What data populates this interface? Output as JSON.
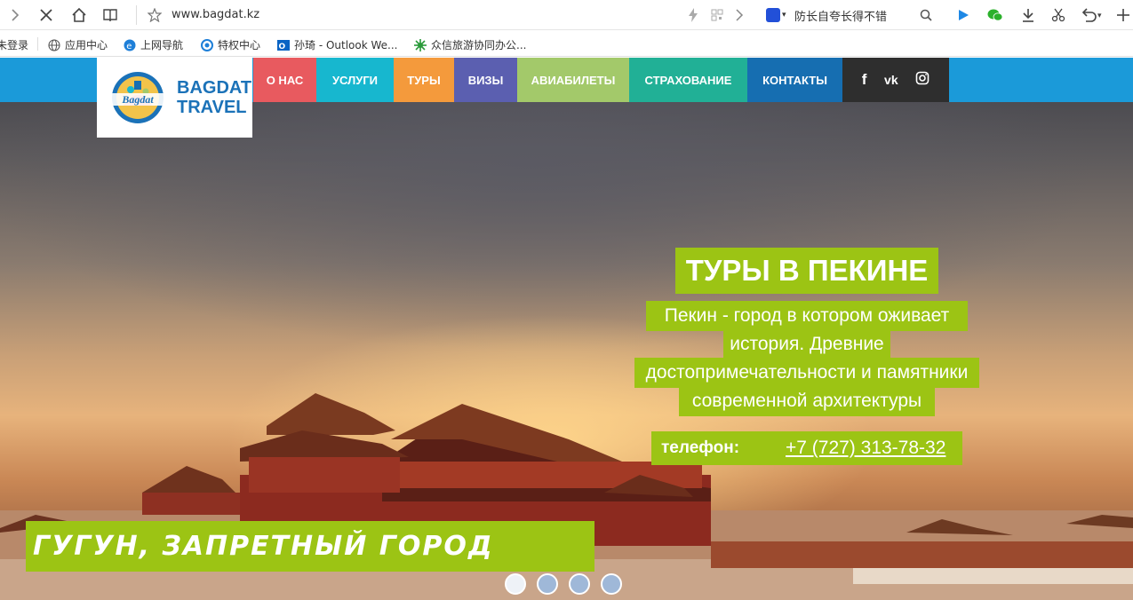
{
  "browser": {
    "url": "www.bagdat.kz",
    "search_text": "防长自夸长得不错",
    "colors": {
      "toolbar_bg": "#ffffff",
      "icon": "#444444"
    }
  },
  "bookmarks": [
    {
      "label": "未登录"
    },
    {
      "label": "应用中心",
      "icon": "globe-icon"
    },
    {
      "label": "上网导航",
      "icon": "ie-icon"
    },
    {
      "label": "特权中心",
      "icon": "privilege-icon"
    },
    {
      "label": "孙琦 - Outlook We...",
      "icon": "outlook-icon"
    },
    {
      "label": "众信旅游协同办公...",
      "icon": "uto-icon"
    }
  ],
  "site": {
    "logo": {
      "line1": "BAGDAT",
      "line2": "TRAVEL",
      "script": "Bagdat"
    },
    "nav": [
      {
        "label": "О НАС",
        "color": "#e85a5f"
      },
      {
        "label": "УСЛУГИ",
        "color": "#17b7cf"
      },
      {
        "label": "ТУРЫ",
        "color": "#f49a3c"
      },
      {
        "label": "ВИЗЫ",
        "color": "#5b5fb0"
      },
      {
        "label": "АВИАБИЛЕТЫ",
        "color": "#a3c96a"
      },
      {
        "label": "СТРАХОВАНИЕ",
        "color": "#21b096"
      },
      {
        "label": "КОНТАКТЫ",
        "color": "#166eb1"
      }
    ],
    "social": {
      "facebook": "f",
      "vk": "vk",
      "instagram": "instagram-icon"
    },
    "colors": {
      "navbar": "#1b9ad9",
      "accent": "#9cc414",
      "social_bg": "#2e2e2e"
    }
  },
  "slide": {
    "title": "ТУРЫ В ПЕКИНЕ",
    "description_lines": [
      "Пекин - город в котором оживает",
      "история. Древние",
      "достопримечательности и памятники",
      "современной архитектуры"
    ],
    "phone_label": "телефон:",
    "phone": "+7 (727) 313-78-32",
    "caption": "Гугун, запретный город"
  },
  "slider": {
    "dots": 4,
    "active": 1
  }
}
